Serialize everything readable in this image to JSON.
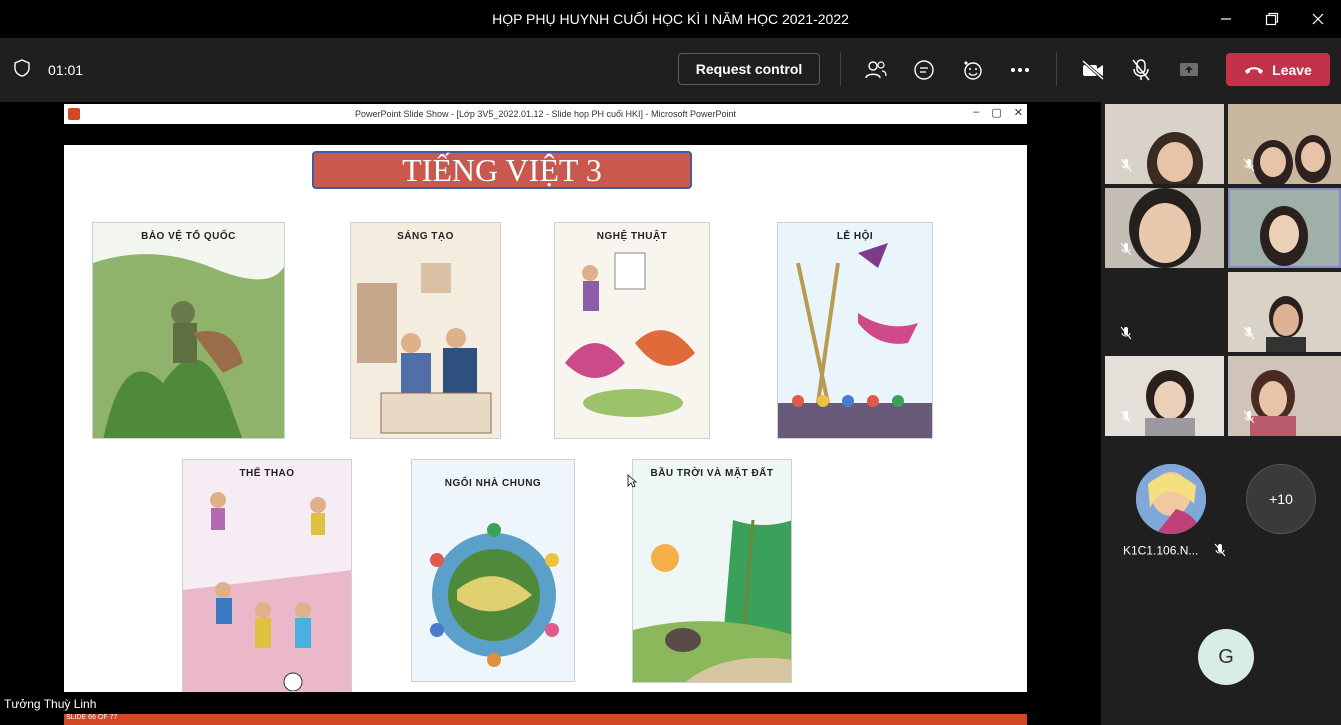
{
  "window": {
    "title": "HỌP PHỤ HUYNH CUỐI HỌC KÌ I NĂM HỌC 2021-2022",
    "controls": [
      "minimize",
      "restore",
      "close"
    ]
  },
  "toolbar": {
    "timer": "01:01",
    "request_control_label": "Request control",
    "leave_label": "Leave",
    "icons": [
      "shield-icon",
      "participants-icon",
      "chat-icon",
      "reactions-icon",
      "more-icon",
      "camera-off-icon",
      "mic-off-icon",
      "share-icon",
      "phone-icon"
    ]
  },
  "powerpoint": {
    "window_title": "PowerPoint Slide Show - [Lớp 3V5_2022.01.12 - Slide họp PH cuối HKI] - Microsoft PowerPoint",
    "status": "SLIDE 66 OF 77"
  },
  "slide": {
    "title": "TIẾNG VIỆT 3",
    "books": [
      {
        "label": "BẢO VỆ TỔ QUỐC"
      },
      {
        "label": "SÁNG TẠO"
      },
      {
        "label": "NGHỆ THUẬT"
      },
      {
        "label": "LỄ HỘI"
      },
      {
        "label": "THỂ THAO"
      },
      {
        "label": "NGÔI NHÀ CHUNG"
      },
      {
        "label": "BẦU TRỜI VÀ MẶT ĐẤT"
      }
    ]
  },
  "presenter": {
    "name": "Tưởng Thuỳ Linh"
  },
  "participants": {
    "named": "K1C1.106.N...",
    "overflow": "+10",
    "initial": "G"
  }
}
